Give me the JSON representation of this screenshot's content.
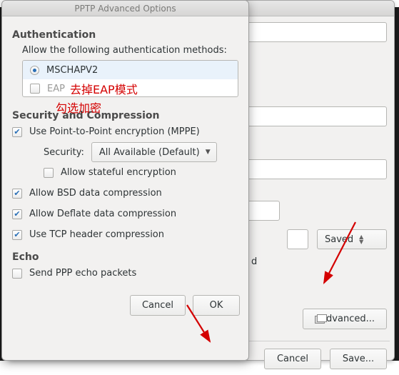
{
  "front": {
    "title": "PPTP Advanced Options",
    "auth": {
      "heading": "Authentication",
      "allow_label": "Allow the following authentication methods:",
      "methods": {
        "mschapv2": {
          "label": "MSCHAPV2",
          "selected": true
        },
        "eap": {
          "label": "EAP",
          "selected": false
        }
      }
    },
    "sec": {
      "heading": "Security and Compression",
      "mppe": {
        "label": "Use Point-to-Point encryption (MPPE)",
        "checked": true
      },
      "security_label": "Security:",
      "security_value": "All Available (Default)",
      "stateful": {
        "label": "Allow stateful encryption",
        "checked": false
      },
      "bsd": {
        "label": "Allow BSD data compression",
        "checked": true
      },
      "deflate": {
        "label": "Allow Deflate data compression",
        "checked": true
      },
      "tcp": {
        "label": "Use TCP header compression",
        "checked": true
      }
    },
    "echo": {
      "heading": "Echo",
      "send": {
        "label": "Send PPP echo packets",
        "checked": false
      }
    },
    "buttons": {
      "cancel": "Cancel",
      "ok": "OK"
    }
  },
  "parent": {
    "saved_select": "Saved",
    "field_tail": "d",
    "advanced": "Advanced...",
    "cancel": "Cancel",
    "save": "Save..."
  },
  "annotations": {
    "line1": "去掉EAP模式",
    "line2": "勾选加密"
  }
}
